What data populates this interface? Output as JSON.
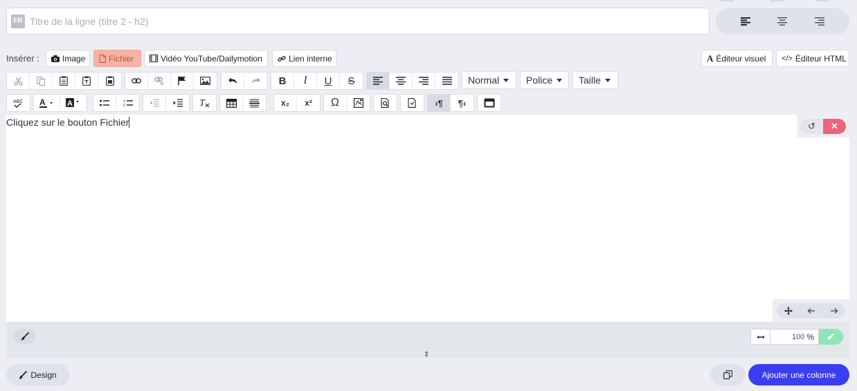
{
  "title_row": {
    "lang_badge": "FR",
    "title_placeholder": "Titre de la ligne (titre 2 - h2)",
    "align_buttons": [
      "align-left-icon",
      "align-center-icon",
      "align-right-icon"
    ]
  },
  "insert_bar": {
    "label": "Insérer :",
    "buttons": [
      {
        "label": "Image",
        "icon": "camera-icon"
      },
      {
        "label": "Fichier",
        "icon": "file-icon",
        "active": true
      },
      {
        "label": "Vidéo YouTube/Dailymotion",
        "icon": "film-icon"
      },
      {
        "label": "Lien interne",
        "icon": "link-icon"
      }
    ],
    "visual_editor": "Éditeur visuel",
    "visual_editor_glyph": "A",
    "html_editor": "Éditeur HTML",
    "html_editor_glyph": "</>"
  },
  "toolbar": {
    "format_select": "Normal",
    "font_select": "Police",
    "size_select": "Taille",
    "bold": "B",
    "italic": "I",
    "underline": "U",
    "strike": "S",
    "subscript": "x₂",
    "superscript": "x²",
    "omega": "Ω",
    "ltr": "›¶",
    "rtl": "¶‹"
  },
  "editor": {
    "content": "Cliquez sur le bouton Fichier",
    "undo_glyph": "↺",
    "close_glyph": "✕"
  },
  "footer": {
    "width_value": "100",
    "width_unit": "%",
    "ok_glyph": "✔",
    "resize_glyph": "⇕",
    "design_label": "Design",
    "add_column_label": "Ajouter une colonne"
  },
  "colors": {
    "accent": "#3b3df0",
    "active_insert": "#f6b3a4",
    "close": "#f0637c",
    "confirm": "#8ee6b7"
  }
}
